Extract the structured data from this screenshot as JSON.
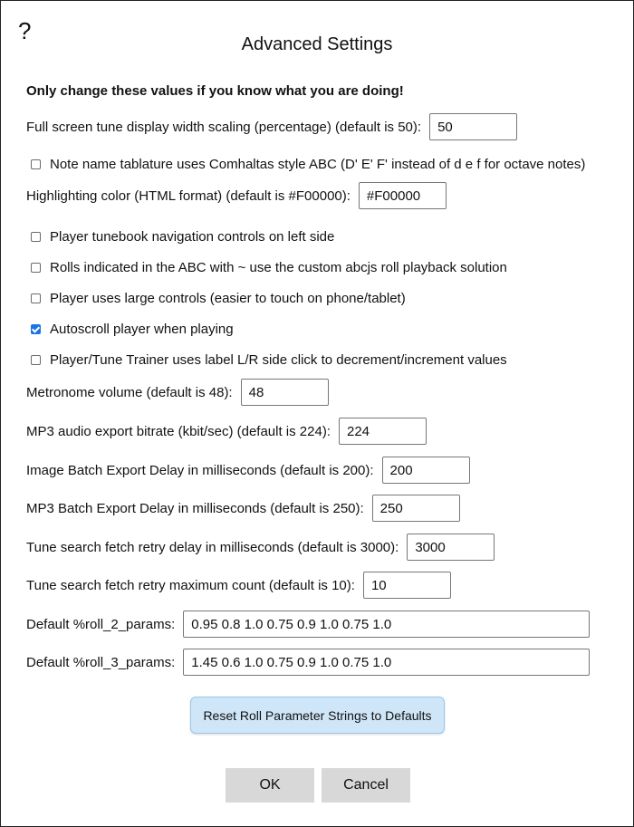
{
  "dialog": {
    "help_glyph": "?",
    "title": "Advanced Settings",
    "warning": "Only change these values if you know what you are doing!"
  },
  "settings": {
    "fullscreen_scaling": {
      "label": "Full screen tune display width scaling (percentage) (default is 50):",
      "value": "50"
    },
    "comhaltas_abc": {
      "label": "Note name tablature uses Comhaltas style ABC (D' E' F' instead of d e f for octave notes)",
      "checked": false
    },
    "highlight_color": {
      "label": "Highlighting color (HTML format) (default is #F00000):",
      "value": "#F00000"
    },
    "nav_left": {
      "label": "Player tunebook navigation controls on left side",
      "checked": false
    },
    "rolls_custom": {
      "label": "Rolls indicated in the ABC with ~ use the custom abcjs roll playback solution",
      "checked": false
    },
    "large_controls": {
      "label": "Player uses large controls (easier to touch on phone/tablet)",
      "checked": false
    },
    "autoscroll": {
      "label": "Autoscroll player when playing",
      "checked": true
    },
    "label_lr_click": {
      "label": "Player/Tune Trainer uses label L/R side click to decrement/increment values",
      "checked": false
    },
    "metronome_volume": {
      "label": "Metronome volume (default is 48):",
      "value": "48"
    },
    "mp3_bitrate": {
      "label": "MP3 audio export bitrate (kbit/sec) (default is 224):",
      "value": "224"
    },
    "image_batch_delay": {
      "label": "Image Batch Export Delay in milliseconds (default is 200):",
      "value": "200"
    },
    "mp3_batch_delay": {
      "label": "MP3 Batch Export Delay in milliseconds (default is 250):",
      "value": "250"
    },
    "search_retry_delay": {
      "label": "Tune search fetch retry delay in milliseconds (default is 3000):",
      "value": "3000"
    },
    "search_retry_count": {
      "label": "Tune search fetch retry maximum count (default is 10):",
      "value": "10"
    },
    "roll_2_params": {
      "label": "Default %roll_2_params:",
      "value": "0.95 0.8 1.0 0.75 0.9 1.0 0.75 1.0"
    },
    "roll_3_params": {
      "label": "Default %roll_3_params:",
      "value": "1.45 0.6 1.0 0.75 0.9 1.0 0.75 1.0"
    }
  },
  "buttons": {
    "reset_rolls": "Reset Roll Parameter Strings to Defaults",
    "ok": "OK",
    "cancel": "Cancel"
  },
  "colors": {
    "accent": "#1a73e8",
    "reset_button_bg": "#cfe6f8",
    "dialog_button_bg": "#d8d8d8"
  }
}
